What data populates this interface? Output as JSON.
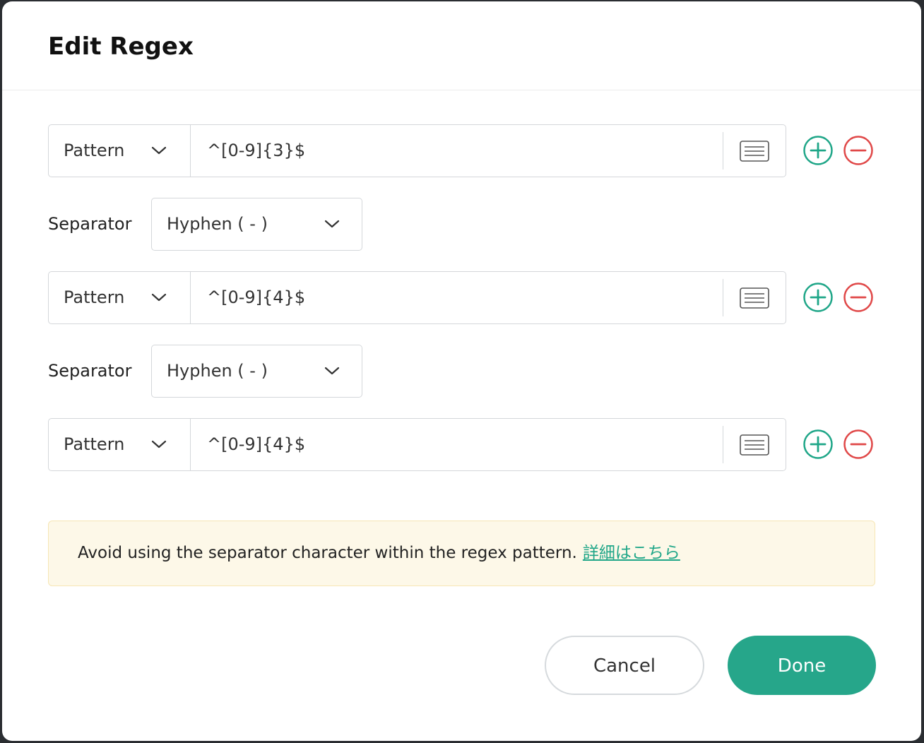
{
  "dialog": {
    "title": "Edit Regex"
  },
  "rows": [
    {
      "type_label": "Pattern",
      "pattern": "^[0-9]{3}$"
    },
    {
      "type_label": "Pattern",
      "pattern": "^[0-9]{4}$"
    },
    {
      "type_label": "Pattern",
      "pattern": "^[0-9]{4}$"
    }
  ],
  "separators": [
    {
      "label": "Separator",
      "value": "Hyphen ( - )"
    },
    {
      "label": "Separator",
      "value": "Hyphen ( - )"
    }
  ],
  "notice": {
    "text": "Avoid using the separator character within the regex pattern.",
    "link": "詳細はこちら"
  },
  "buttons": {
    "cancel": "Cancel",
    "done": "Done"
  },
  "icons": {
    "type_chevron": "chevron-down-icon",
    "list": "list-lines-icon",
    "add": "plus-circle-icon",
    "remove": "minus-circle-icon"
  },
  "colors": {
    "accent": "#26a68a",
    "add": "#1fa688",
    "remove": "#e04848",
    "notice_bg": "#fdf8e8"
  }
}
